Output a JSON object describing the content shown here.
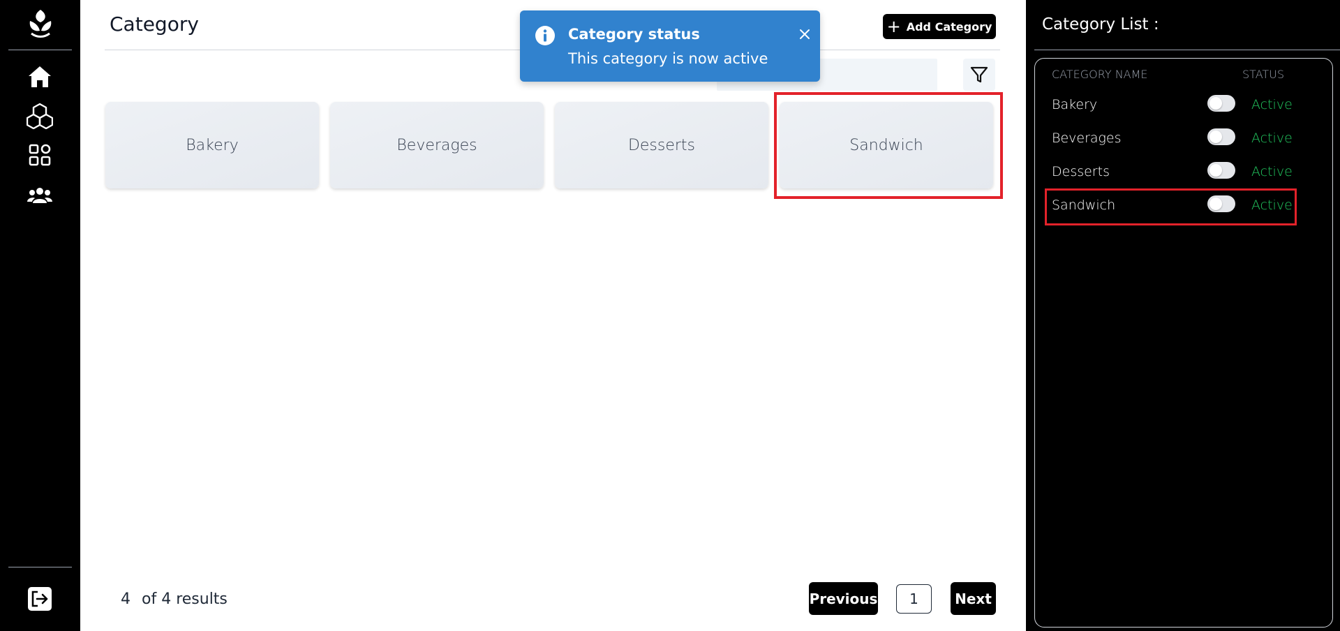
{
  "main": {
    "title": "Category",
    "add_button_label": "Add Category",
    "search_placeholder": "",
    "categories": [
      "Bakery",
      "Beverages",
      "Desserts",
      "Sandwich"
    ]
  },
  "pagination": {
    "count": "4",
    "results_text": "of 4 results",
    "previous_label": "Previous",
    "page": "1",
    "next_label": "Next"
  },
  "toast": {
    "title": "Category status",
    "message": "This category is now active"
  },
  "right_panel": {
    "title": "Category List :",
    "col_name": "CATEGORY NAME",
    "col_status": "STATUS",
    "rows": [
      {
        "name": "Bakery",
        "status": "Active"
      },
      {
        "name": "Beverages",
        "status": "Active"
      },
      {
        "name": "Desserts",
        "status": "Active"
      },
      {
        "name": "Sandwich",
        "status": "Active"
      }
    ]
  },
  "colors": {
    "toast_bg": "#3182ce",
    "status_active": "#22c55e",
    "highlight": "#e3222a"
  },
  "icons": [
    "logo-icon",
    "home-icon",
    "cubes-icon",
    "apps-icon",
    "users-icon",
    "logout-icon",
    "plus-icon",
    "filter-icon",
    "info-icon",
    "close-icon"
  ]
}
